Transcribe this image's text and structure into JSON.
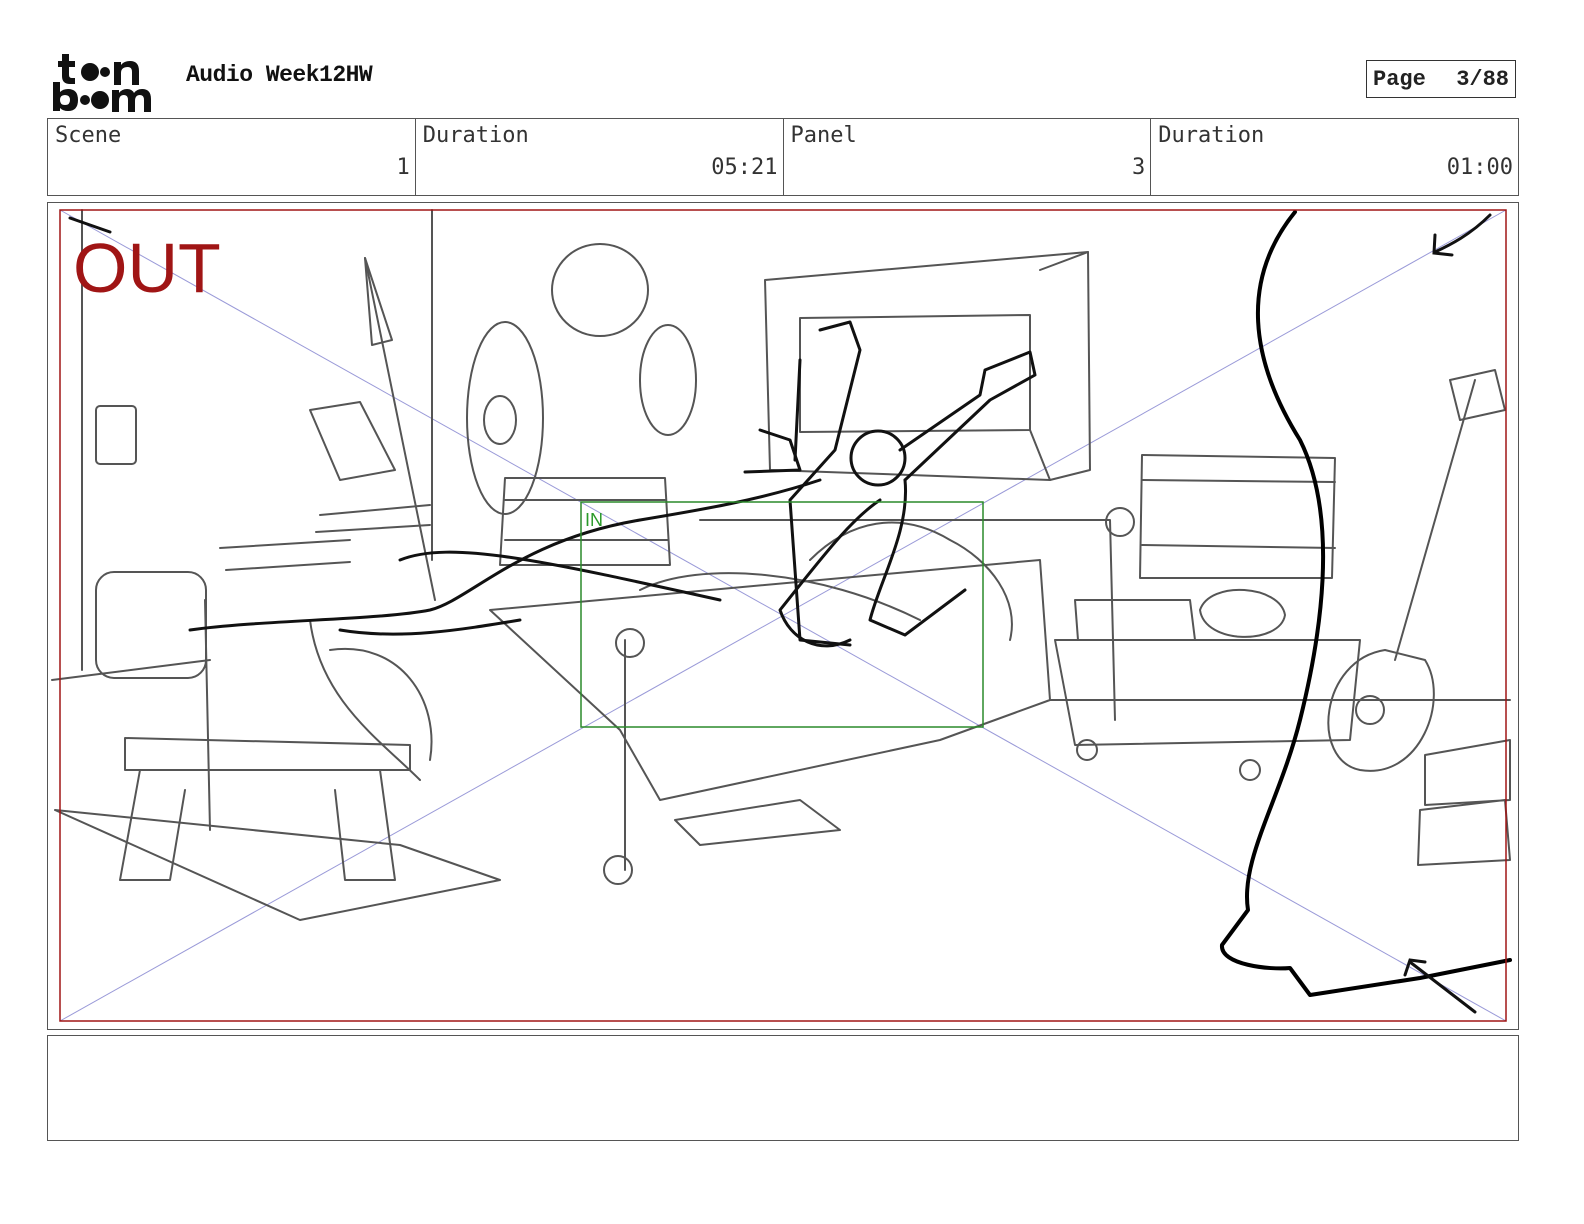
{
  "header": {
    "brand_line1": "toon",
    "brand_line2": "boom",
    "title": "Audio Week12HW",
    "page_label": "Page",
    "page_value": "3/88"
  },
  "info": [
    {
      "label": "Scene",
      "value": "1"
    },
    {
      "label": "Duration",
      "value": "05:21"
    },
    {
      "label": "Panel",
      "value": "3"
    },
    {
      "label": "Duration",
      "value": "01:00"
    }
  ],
  "panel": {
    "out_label": "OUT",
    "in_label": "IN",
    "colors": {
      "out_frame": "#a01515",
      "in_frame": "#2a8a2a",
      "guides": "#9a9ad8"
    }
  },
  "notes": {
    "text": ""
  }
}
